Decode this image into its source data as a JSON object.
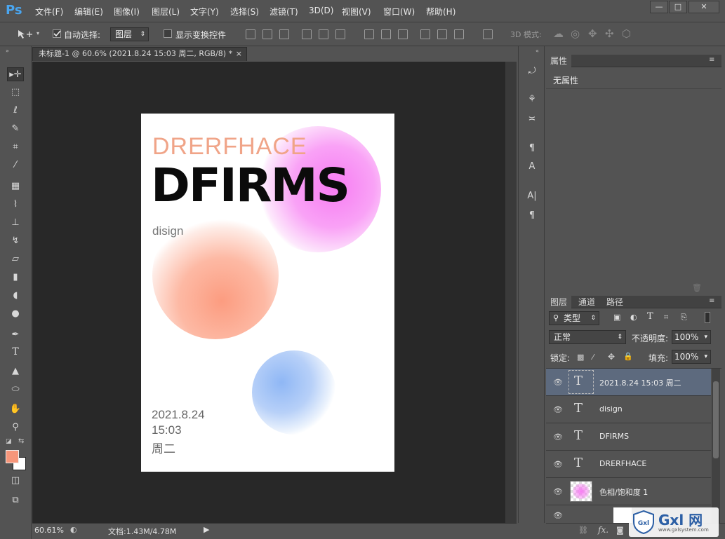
{
  "app": {
    "logo": "Ps",
    "menu": [
      "文件(F)",
      "编辑(E)",
      "图像(I)",
      "图层(L)",
      "文字(Y)",
      "选择(S)",
      "滤镜(T)",
      "3D(D)",
      "视图(V)",
      "窗口(W)",
      "帮助(H)"
    ],
    "window_controls": [
      "—",
      "□",
      "✕"
    ]
  },
  "options": {
    "auto_select_label": "自动选择:",
    "auto_select_value": "图层",
    "transform_label": "显示变换控件",
    "mode3d_label": "3D 模式:"
  },
  "document": {
    "tab_title": "未标题-1 @ 60.6% (2021.8.24  15:03 周二, RGB/8) *",
    "close": "×",
    "zoom": "60.61%",
    "doc_size": "文档:1.43M/4.78M",
    "poster": {
      "title_small": "DRERFHACE",
      "title_big": "DFIRMS",
      "subtitle": "disign",
      "date": "2021.8.24",
      "time": "15:03",
      "weekday": "周二"
    }
  },
  "colors": {
    "foreground": "#f7967a",
    "background": "#ffffff",
    "accent_salmon": "#f0a488",
    "pink_blob": "#f77bf2",
    "orange_blob": "#fc9c80",
    "blue_blob": "#8fb7f5"
  },
  "properties": {
    "tab": "属性",
    "no_props": "无属性"
  },
  "layers_panel": {
    "tabs": [
      "图层",
      "通道",
      "路径"
    ],
    "filter": "类型",
    "blend_mode": "正常",
    "opacity_label": "不透明度:",
    "opacity": "100%",
    "lock_label": "锁定:",
    "fill_label": "填充:",
    "fill": "100%",
    "layers": [
      {
        "name": "2021.8.24  15:03 周二",
        "kind": "text"
      },
      {
        "name": "disign",
        "kind": "text"
      },
      {
        "name": "DFIRMS",
        "kind": "text"
      },
      {
        "name": "DRERFHACE",
        "kind": "text"
      },
      {
        "name": "色相/饱和度 1",
        "kind": "adjustment"
      }
    ],
    "footer_fx": "fx."
  },
  "watermark": {
    "brand": "Gxl 网",
    "url": "www.gxlsystem.com"
  }
}
